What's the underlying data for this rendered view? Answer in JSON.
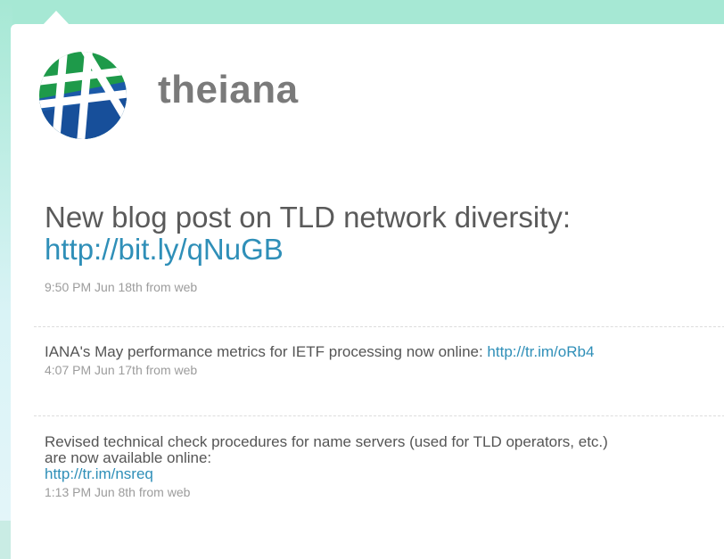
{
  "profile": {
    "screen_name": "theiana"
  },
  "main_tweet": {
    "text": "New blog post on TLD network diversity: ",
    "link": "http://bit.ly/qNuGB",
    "meta": "9:50 PM Jun 18th from web"
  },
  "timeline": [
    {
      "text": "IANA's May performance metrics for IETF processing now online: ",
      "link": "http://tr.im/oRb4",
      "meta": "4:07 PM Jun 17th from web"
    },
    {
      "text": "Revised technical check procedures for name servers (used for TLD operators, etc.) are now available online:",
      "link": "http://tr.im/nsreq",
      "meta": "1:13 PM Jun 8th from web"
    }
  ],
  "colors": {
    "link": "#2f8fb8",
    "background": "#a6e8d4"
  }
}
